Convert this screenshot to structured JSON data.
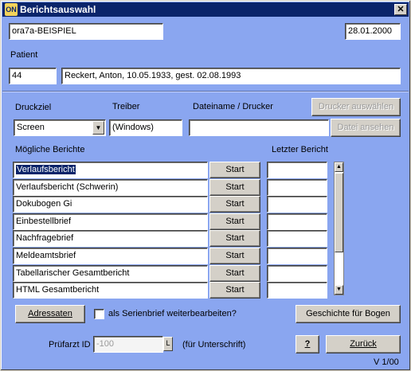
{
  "window": {
    "title": "Berichtsauswahl",
    "icon_text": "ON",
    "close_glyph": "✕"
  },
  "header": {
    "database": "ora7a-BEISPIEL",
    "date": "28.01.2000",
    "patient_label": "Patient",
    "patient_id": "44",
    "patient_info": "Reckert, Anton, 10.05.1933, gest. 02.08.1993"
  },
  "output": {
    "druckziel_label": "Druckziel",
    "druckziel_value": "Screen",
    "treiber_label": "Treiber",
    "treiber_value": "(Windows)",
    "dateiname_label": "Dateiname / Drucker",
    "dateiname_value": "",
    "drucker_button": "Drucker auswählen",
    "datei_button": "Datei ansehen"
  },
  "reports": {
    "list_label": "Mögliche Berichte",
    "last_label": "Letzter Bericht",
    "start_label": "Start",
    "items": [
      {
        "name": "Verlaufsbericht",
        "last": ""
      },
      {
        "name": "Verlaufsbericht (Schwerin)",
        "last": ""
      },
      {
        "name": "Dokubogen Gi",
        "last": ""
      },
      {
        "name": "Einbestellbrief",
        "last": ""
      },
      {
        "name": "Nachfragebrief",
        "last": ""
      },
      {
        "name": "Meldeamtsbrief",
        "last": ""
      },
      {
        "name": "Tabellarischer Gesamtbericht",
        "last": ""
      },
      {
        "name": "HTML Gesamtbericht",
        "last": ""
      }
    ]
  },
  "footer": {
    "adressaten_button": "Adressaten",
    "serienbrief_label": "als Serienbrief weiterbearbeiten?",
    "serienbrief_checked": false,
    "geschichte_button": "Geschichte für Bogen",
    "pruefarzt_label": "Prüfarzt ID",
    "pruefarzt_value": "-100",
    "lov_button": "L",
    "unterschrift_label": "(für Unterschrift)",
    "help_button": "?",
    "zurueck_button": "Zurück",
    "version": "V 1/00"
  }
}
